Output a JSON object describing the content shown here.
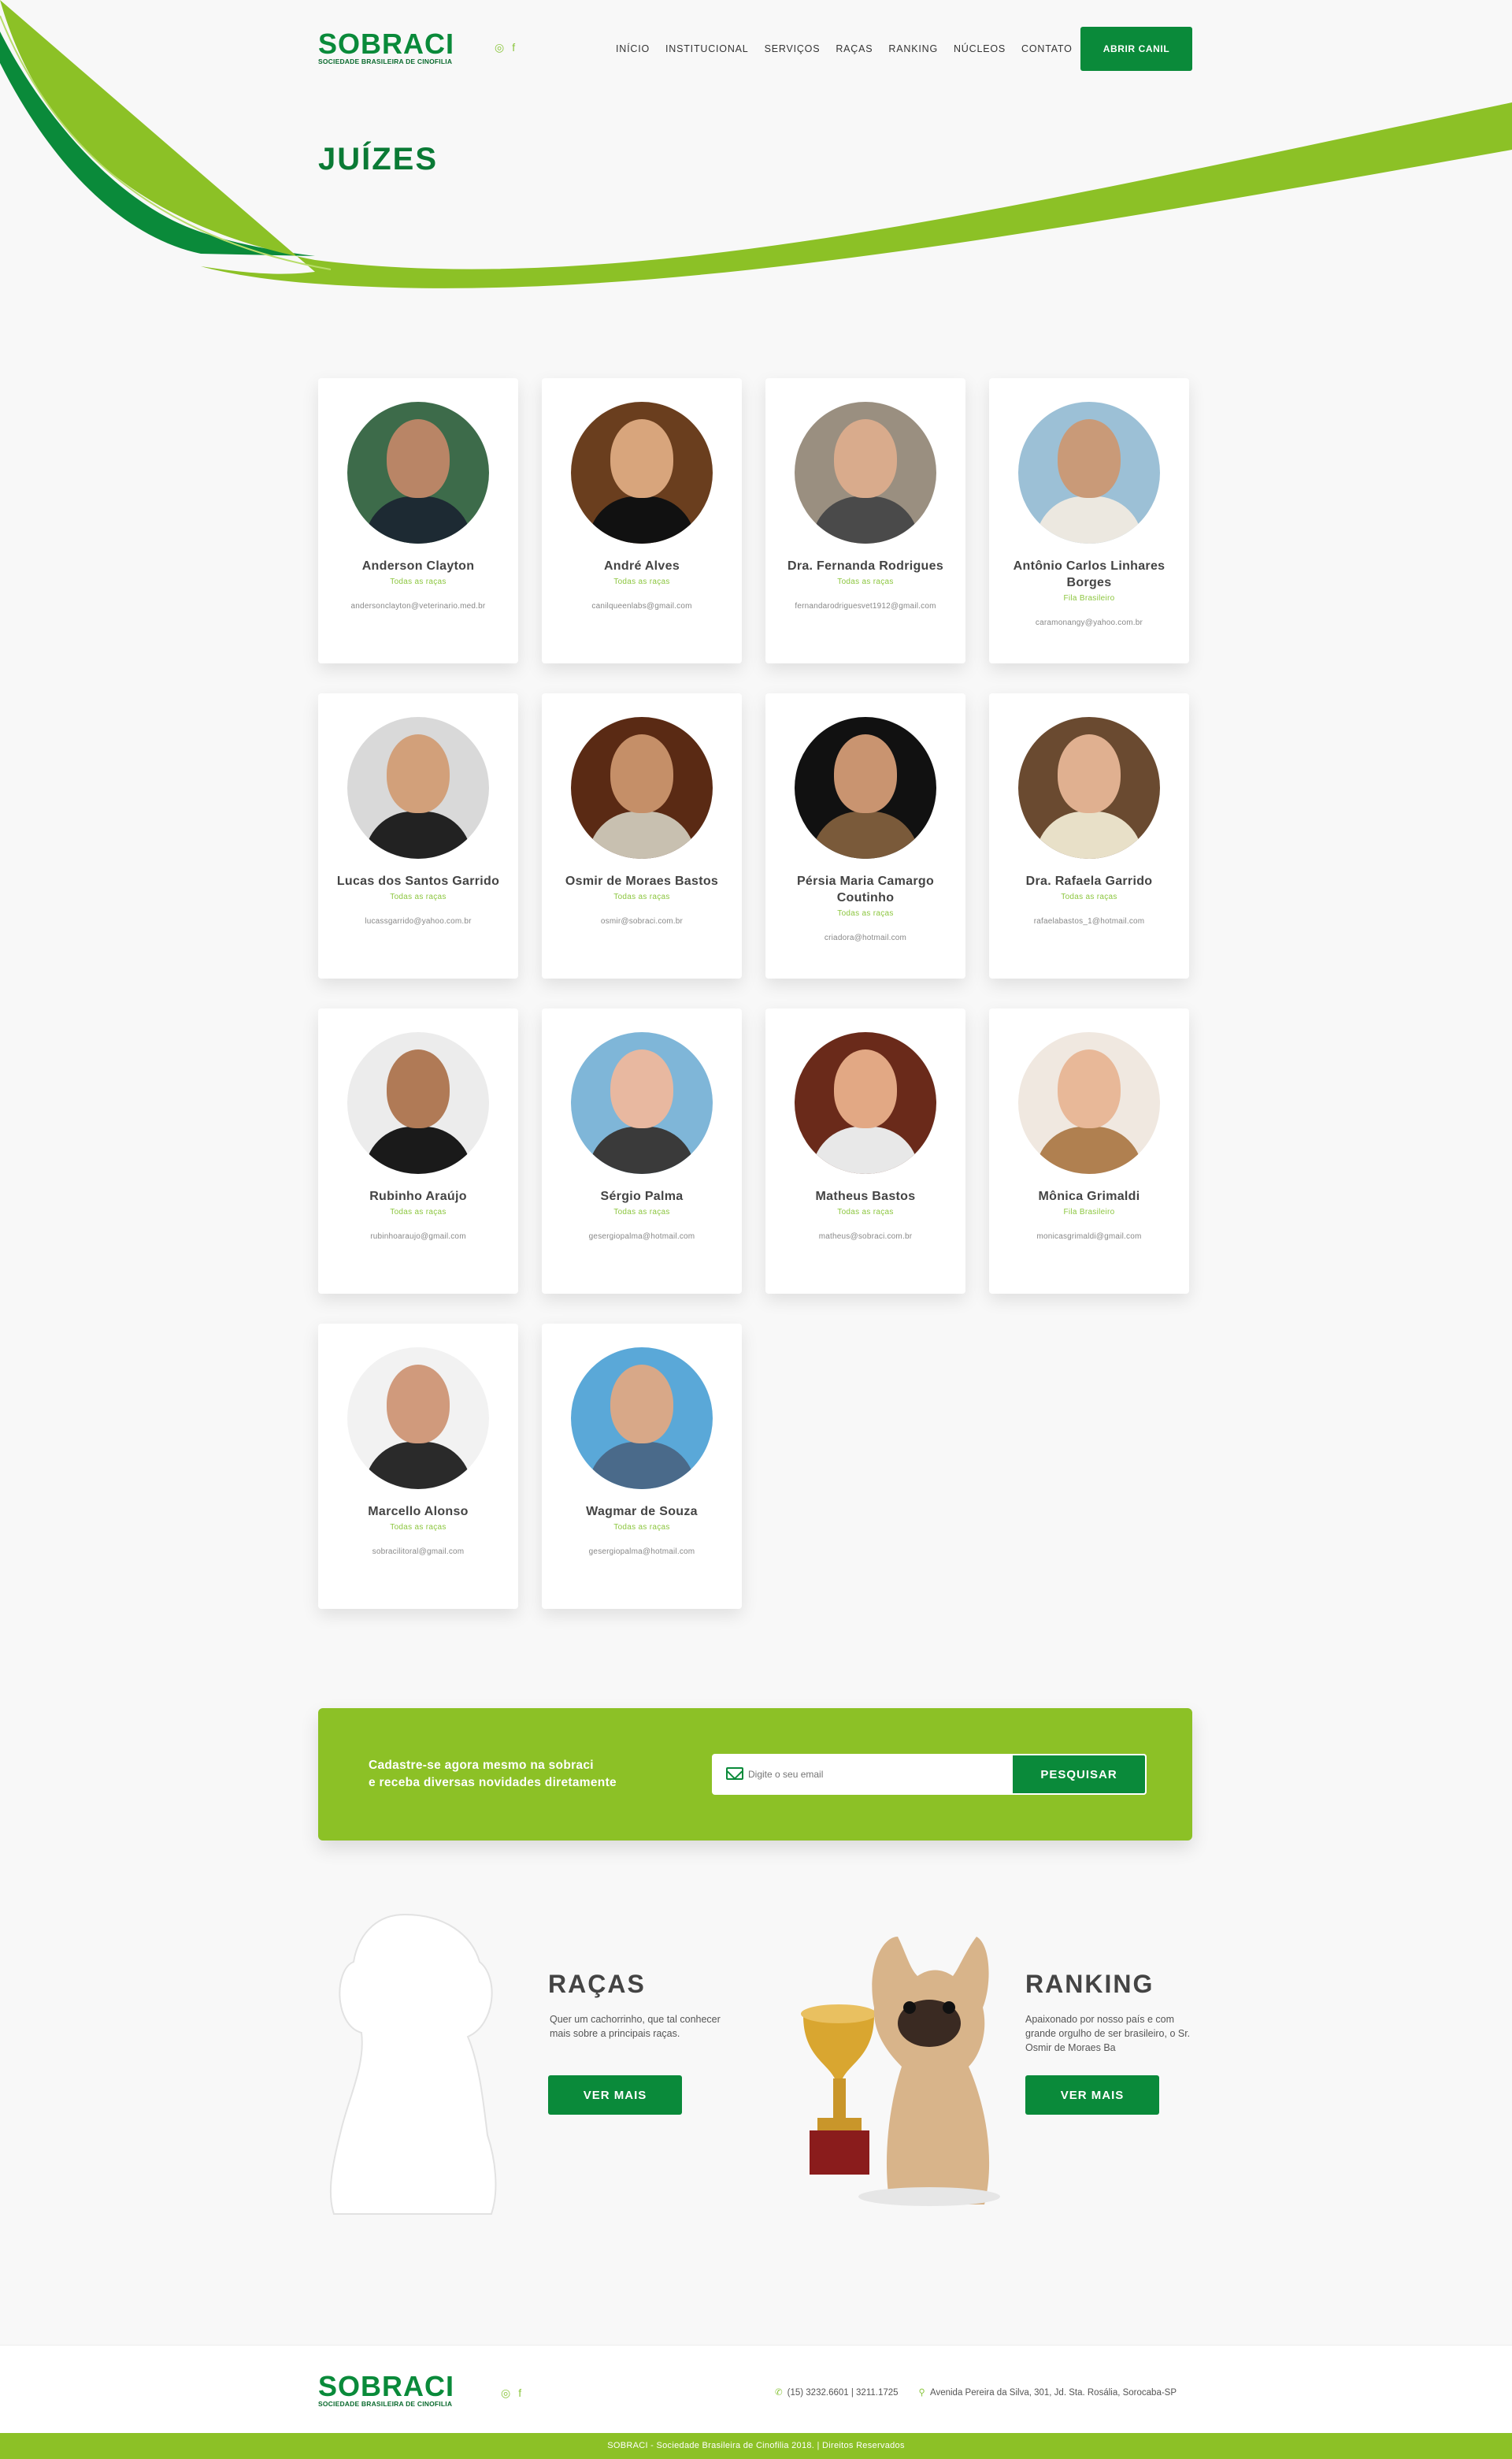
{
  "brand": {
    "name": "SOBRACI",
    "tagline": "SOCIEDADE BRASILEIRA DE CINOFILIA",
    "primary_color": "#0a8a3a",
    "accent_color": "#8cc126"
  },
  "header": {
    "social": [
      "instagram-icon",
      "facebook-icon"
    ],
    "nav": [
      "INÍCIO",
      "INSTITUCIONAL",
      "SERVIÇOS",
      "RAÇAS",
      "RANKING",
      "NÚCLEOS",
      "CONTATO"
    ],
    "cta": "ABRIR CANIL"
  },
  "page_title": "JUÍZES",
  "judges": [
    {
      "name": "Anderson Clayton",
      "breed": "Todas as raças",
      "email": "andersonclayton@veterinario.med.br"
    },
    {
      "name": "André Alves",
      "breed": "Todas as raças",
      "email": "canilqueenlabs@gmail.com"
    },
    {
      "name": "Dra. Fernanda Rodrigues",
      "breed": "Todas as raças",
      "email": "fernandarodriguesvet1912@gmail.com"
    },
    {
      "name": "Antônio Carlos Linhares Borges",
      "breed": "Fila Brasileiro",
      "email": "caramonangy@yahoo.com.br"
    },
    {
      "name": "Lucas dos Santos Garrido",
      "breed": "Todas as raças",
      "email": "lucassgarrido@yahoo.com.br"
    },
    {
      "name": "Osmir de Moraes Bastos",
      "breed": "Todas as raças",
      "email": "osmir@sobraci.com.br"
    },
    {
      "name": "Pérsia Maria Camargo Coutinho",
      "breed": "Todas as raças",
      "email": "criadora@hotmail.com"
    },
    {
      "name": "Dra. Rafaela Garrido",
      "breed": "Todas as raças",
      "email": "rafaelabastos_1@hotmail.com"
    },
    {
      "name": "Rubinho Araújo",
      "breed": "Todas as raças",
      "email": "rubinhoaraujo@gmail.com"
    },
    {
      "name": "Sérgio Palma",
      "breed": "Todas as raças",
      "email": "gesergiopalma@hotmail.com"
    },
    {
      "name": "Matheus Bastos",
      "breed": "Todas as raças",
      "email": "matheus@sobraci.com.br"
    },
    {
      "name": "Mônica Grimaldi",
      "breed": "Fila Brasileiro",
      "email": "monicasgrimaldi@gmail.com"
    },
    {
      "name": "Marcello Alonso",
      "breed": "Todas as raças",
      "email": "sobracilitoral@gmail.com"
    },
    {
      "name": "Wagmar de Souza",
      "breed": "Todas as raças",
      "email": "gesergiopalma@hotmail.com"
    }
  ],
  "newsletter": {
    "line1": "Cadastre-se agora mesmo na sobraci",
    "line2": "e receba diversas novidades diretamente",
    "placeholder": "Digite o seu email",
    "button": "PESQUISAR"
  },
  "racas": {
    "title": "RAÇAS",
    "text": "Quer um cachorrinho, que tal conhecer mais sobre a principais raças.",
    "button": "VER MAIS"
  },
  "ranking": {
    "title": "RANKING",
    "text": "Apaixonado por nosso país e com grande orgulho de ser brasileiro, o Sr. Osmir de Moraes Ba",
    "button": "VER MAIS"
  },
  "footer": {
    "phone": "(15) 3232.6601 | 3211.1725",
    "address": "Avenida Pereira da Silva, 301, Jd. Sta. Rosália, Sorocaba-SP",
    "copyright": "SOBRACI - Sociedade Brasileira de Cinofilia 2018. | Direitos Reservados"
  }
}
